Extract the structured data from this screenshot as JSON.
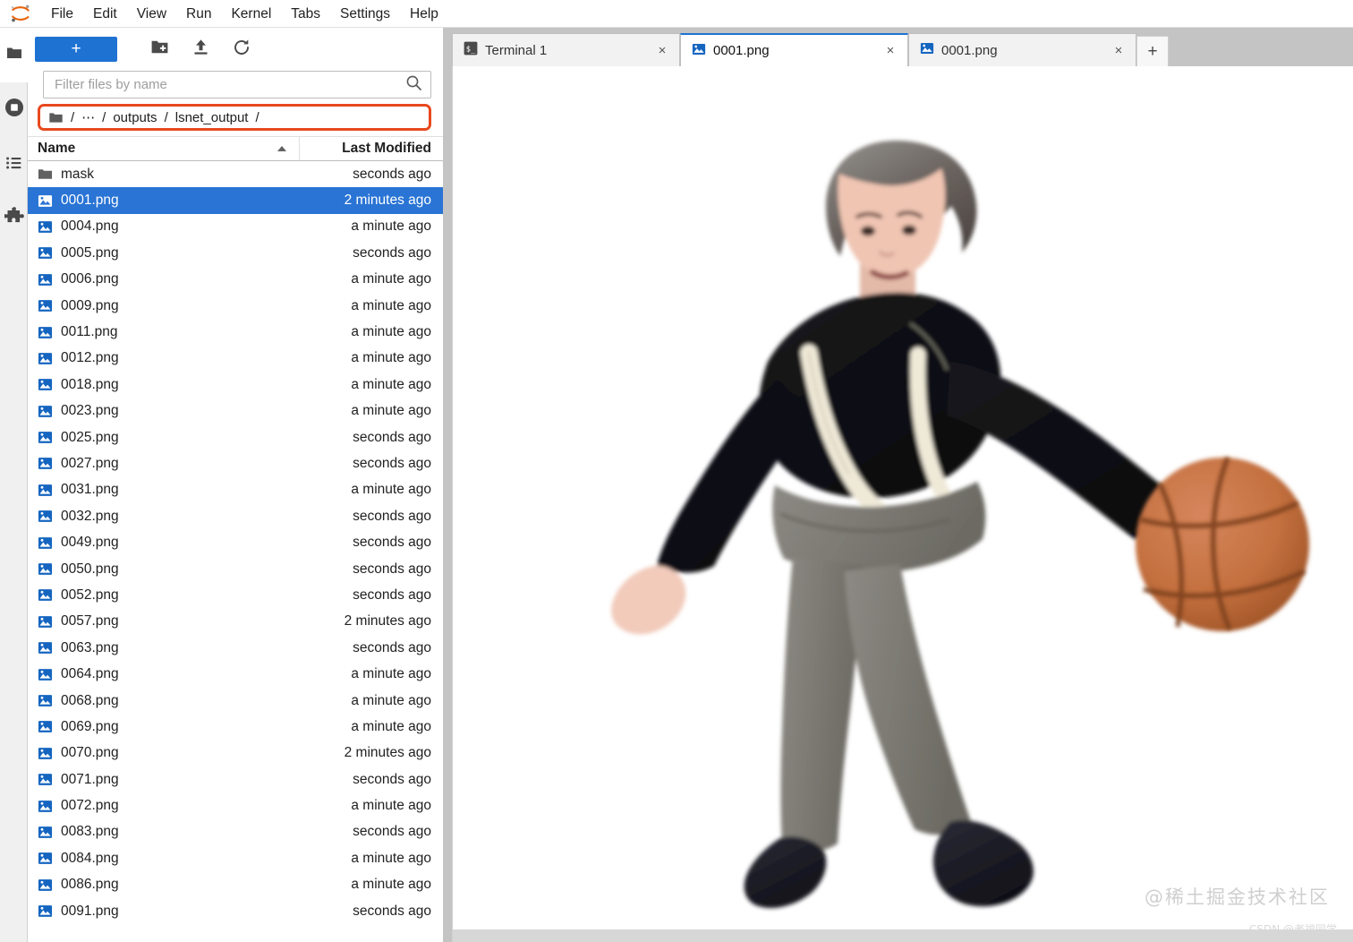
{
  "app": {
    "logo_name": "jupyterlab-logo",
    "accent_blue": "#1e72d2",
    "selection_blue": "#2974d4",
    "highlight_orange": "#e8491f"
  },
  "menubar": {
    "items": [
      {
        "label": "File"
      },
      {
        "label": "Edit"
      },
      {
        "label": "View"
      },
      {
        "label": "Run"
      },
      {
        "label": "Kernel"
      },
      {
        "label": "Tabs"
      },
      {
        "label": "Settings"
      },
      {
        "label": "Help"
      }
    ]
  },
  "activitybar": {
    "items": [
      {
        "icon": "folder-icon",
        "label": "File Browser"
      },
      {
        "icon": "running-stop-icon",
        "label": "Running Terminals and Kernels"
      },
      {
        "icon": "list-icon",
        "label": "Table of Contents"
      },
      {
        "icon": "puzzle-icon",
        "label": "Extension Manager"
      }
    ]
  },
  "filebrowser": {
    "toolbar": {
      "new_launcher_label": "+",
      "new_folder_icon": "new-folder-icon",
      "upload_icon": "upload-icon",
      "refresh_icon": "refresh-icon"
    },
    "filter": {
      "placeholder": "Filter files by name",
      "value": "",
      "search_icon": "search-icon"
    },
    "breadcrumb": {
      "root_icon": "folder-icon",
      "parts": [
        "/",
        "…",
        "/",
        "outputs",
        "/",
        "lsnet_output",
        "/"
      ],
      "ellipsis": "…",
      "segments": [
        {
          "label": "/"
        },
        {
          "label": "⋯"
        },
        {
          "label": "/"
        },
        {
          "label": "outputs"
        },
        {
          "label": "/"
        },
        {
          "label": "lsnet_output"
        },
        {
          "label": "/"
        }
      ]
    },
    "columns": {
      "name": "Name",
      "last_modified": "Last Modified"
    },
    "sort": {
      "column": "Name",
      "direction": "ascending"
    },
    "rows": [
      {
        "name": "mask",
        "modified": "seconds ago",
        "icon": "folder-icon",
        "selected": false
      },
      {
        "name": "0001.png",
        "modified": "2 minutes ago",
        "icon": "image-file-icon",
        "selected": true
      },
      {
        "name": "0004.png",
        "modified": "a minute ago",
        "icon": "image-file-icon",
        "selected": false
      },
      {
        "name": "0005.png",
        "modified": "seconds ago",
        "icon": "image-file-icon",
        "selected": false
      },
      {
        "name": "0006.png",
        "modified": "a minute ago",
        "icon": "image-file-icon",
        "selected": false
      },
      {
        "name": "0009.png",
        "modified": "a minute ago",
        "icon": "image-file-icon",
        "selected": false
      },
      {
        "name": "0011.png",
        "modified": "a minute ago",
        "icon": "image-file-icon",
        "selected": false
      },
      {
        "name": "0012.png",
        "modified": "a minute ago",
        "icon": "image-file-icon",
        "selected": false
      },
      {
        "name": "0018.png",
        "modified": "a minute ago",
        "icon": "image-file-icon",
        "selected": false
      },
      {
        "name": "0023.png",
        "modified": "a minute ago",
        "icon": "image-file-icon",
        "selected": false
      },
      {
        "name": "0025.png",
        "modified": "seconds ago",
        "icon": "image-file-icon",
        "selected": false
      },
      {
        "name": "0027.png",
        "modified": "seconds ago",
        "icon": "image-file-icon",
        "selected": false
      },
      {
        "name": "0031.png",
        "modified": "a minute ago",
        "icon": "image-file-icon",
        "selected": false
      },
      {
        "name": "0032.png",
        "modified": "seconds ago",
        "icon": "image-file-icon",
        "selected": false
      },
      {
        "name": "0049.png",
        "modified": "seconds ago",
        "icon": "image-file-icon",
        "selected": false
      },
      {
        "name": "0050.png",
        "modified": "seconds ago",
        "icon": "image-file-icon",
        "selected": false
      },
      {
        "name": "0052.png",
        "modified": "seconds ago",
        "icon": "image-file-icon",
        "selected": false
      },
      {
        "name": "0057.png",
        "modified": "2 minutes ago",
        "icon": "image-file-icon",
        "selected": false
      },
      {
        "name": "0063.png",
        "modified": "seconds ago",
        "icon": "image-file-icon",
        "selected": false
      },
      {
        "name": "0064.png",
        "modified": "a minute ago",
        "icon": "image-file-icon",
        "selected": false
      },
      {
        "name": "0068.png",
        "modified": "a minute ago",
        "icon": "image-file-icon",
        "selected": false
      },
      {
        "name": "0069.png",
        "modified": "a minute ago",
        "icon": "image-file-icon",
        "selected": false
      },
      {
        "name": "0070.png",
        "modified": "2 minutes ago",
        "icon": "image-file-icon",
        "selected": false
      },
      {
        "name": "0071.png",
        "modified": "seconds ago",
        "icon": "image-file-icon",
        "selected": false
      },
      {
        "name": "0072.png",
        "modified": "a minute ago",
        "icon": "image-file-icon",
        "selected": false
      },
      {
        "name": "0083.png",
        "modified": "seconds ago",
        "icon": "image-file-icon",
        "selected": false
      },
      {
        "name": "0084.png",
        "modified": "a minute ago",
        "icon": "image-file-icon",
        "selected": false
      },
      {
        "name": "0086.png",
        "modified": "a minute ago",
        "icon": "image-file-icon",
        "selected": false
      },
      {
        "name": "0091.png",
        "modified": "seconds ago",
        "icon": "image-file-icon",
        "selected": false
      }
    ]
  },
  "dock": {
    "tabs": [
      {
        "label": "Terminal 1",
        "icon": "terminal-icon",
        "current": false,
        "close_label": "×"
      },
      {
        "label": "0001.png",
        "icon": "image-file-icon",
        "current": true,
        "close_label": "×"
      },
      {
        "label": "0001.png",
        "icon": "image-file-icon",
        "current": false,
        "close_label": "×"
      }
    ],
    "add_tab_label": "+"
  },
  "viewer": {
    "content_description": "basketball-player-cutout",
    "background": "#ffffff"
  },
  "watermark": {
    "primary": "@稀土掘金技术社区",
    "secondary": "CSDN @老福同学"
  }
}
